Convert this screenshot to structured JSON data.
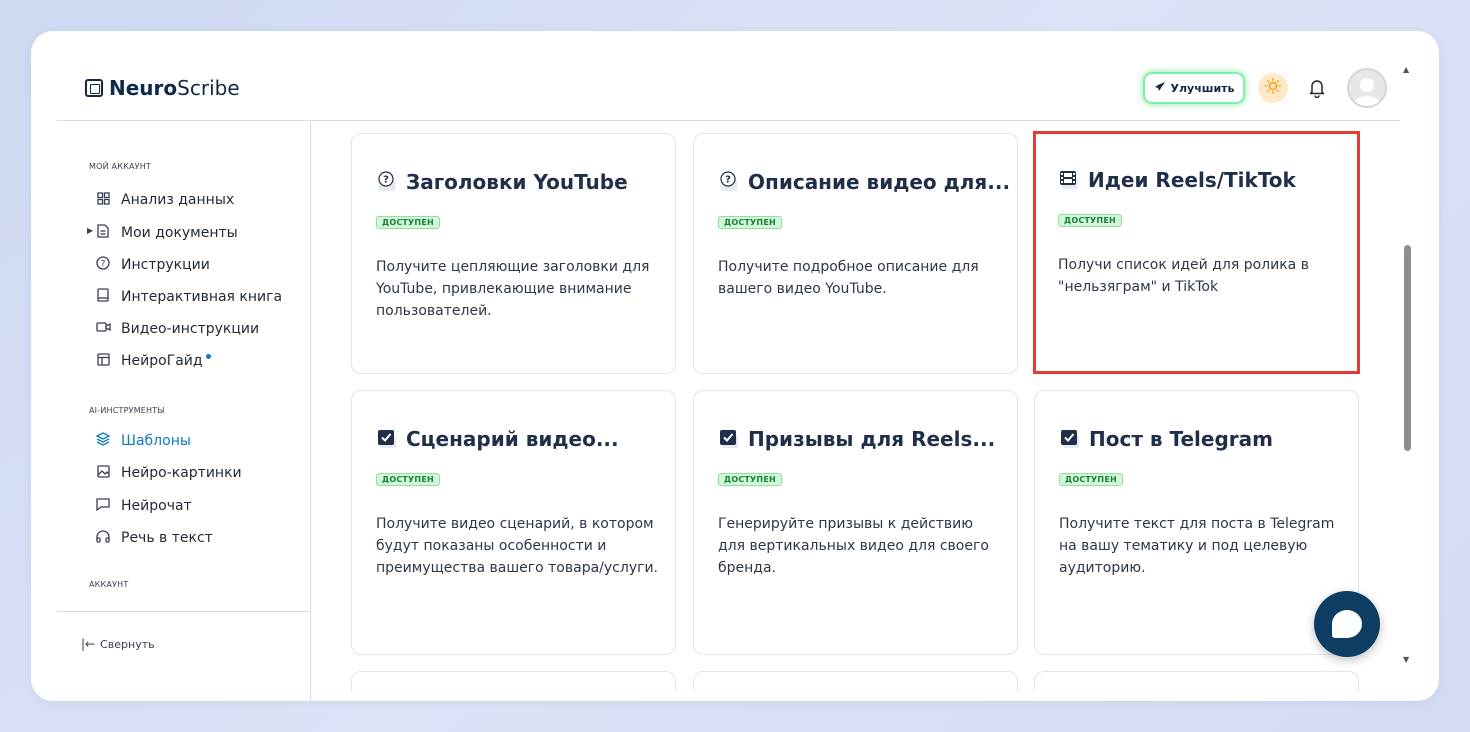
{
  "app": {
    "logo_bold": "Neuro",
    "logo_rest": "Scribe"
  },
  "header": {
    "upgrade_label": "Улучшить"
  },
  "sidebar": {
    "section_account": "МОЙ АККАУНТ",
    "items_account": [
      {
        "label": "Анализ данных",
        "icon": "grid-icon"
      },
      {
        "label": "Мои документы",
        "icon": "document-icon"
      },
      {
        "label": "Инструкции",
        "icon": "help-circle-icon"
      },
      {
        "label": "Интерактивная книга",
        "icon": "book-icon"
      },
      {
        "label": "Видео-инструкции",
        "icon": "video-icon"
      },
      {
        "label": "НейроГайд",
        "icon": "layout-icon"
      }
    ],
    "section_ai": "AI-ИНСТРУМЕНТЫ",
    "items_ai": [
      {
        "label": "Шаблоны",
        "icon": "layers-icon",
        "active": true
      },
      {
        "label": "Нейро-картинки",
        "icon": "image-icon"
      },
      {
        "label": "Нейрочат",
        "icon": "chat-icon"
      },
      {
        "label": "Речь в текст",
        "icon": "headphones-icon"
      }
    ],
    "section_acc2": "АККАУНТ",
    "collapse_label": "Свернуть"
  },
  "cards": [
    {
      "title": "Заголовки YouTube",
      "badge": "доступен",
      "desc": "Получите цепляющие заголовки для YouTube, привлекающие внимание пользователей.",
      "icon": "question-icon"
    },
    {
      "title": "Описание видео для...",
      "badge": "доступен",
      "desc": "Получите подробное описание для вашего видео YouTube.",
      "icon": "question-icon"
    },
    {
      "title": "Идеи Reels/TikTok",
      "badge": "доступен",
      "desc": "Получи список идей для ролика в \"нельзяграм\" и TikTok",
      "icon": "film-icon"
    },
    {
      "title": "Сценарий видео...",
      "badge": "доступен",
      "desc": "Получите видео сценарий, в котором будут показаны особенности и преимущества вашего товара/услуги.",
      "icon": "checkbox-icon"
    },
    {
      "title": "Призывы для Reels...",
      "badge": "доступен",
      "desc": "Генерируйте призывы к действию для вертикальных видео для своего бренда.",
      "icon": "checkbox-icon"
    },
    {
      "title": "Пост в Telegram",
      "badge": "доступен",
      "desc": "Получите текст для поста в Telegram на вашу тематику и под целевую аудиторию.",
      "icon": "checkbox-icon"
    }
  ]
}
